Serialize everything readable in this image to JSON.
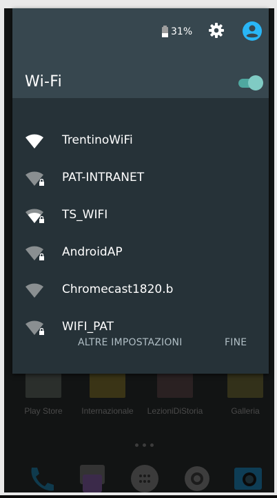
{
  "status": {
    "battery_level": 0.31,
    "battery_text": "31%"
  },
  "quick_settings": {
    "title": "Wi-Fi",
    "wifi_enabled": true,
    "networks": [
      {
        "name": "TrentinoWiFi",
        "locked": false,
        "signal": "full"
      },
      {
        "name": "PAT-INTRANET",
        "locked": true,
        "signal": "weak"
      },
      {
        "name": "TS_WIFI",
        "locked": true,
        "signal": "full"
      },
      {
        "name": "AndroidAP",
        "locked": true,
        "signal": "weak"
      },
      {
        "name": "Chromecast1820.b",
        "locked": false,
        "signal": "weak"
      },
      {
        "name": "WIFI_PAT",
        "locked": true,
        "signal": "weak"
      }
    ],
    "more_settings_label": "ALTRE IMPOSTAZIONI",
    "done_label": "FINE"
  },
  "home": {
    "apps": [
      {
        "label": "Play Store"
      },
      {
        "label": "Internazionale"
      },
      {
        "label": "LezioniDiStoria"
      },
      {
        "label": "Galleria"
      }
    ]
  },
  "colors": {
    "panel": "#263238",
    "header": "#37474f",
    "accent": "#80cbc4"
  }
}
